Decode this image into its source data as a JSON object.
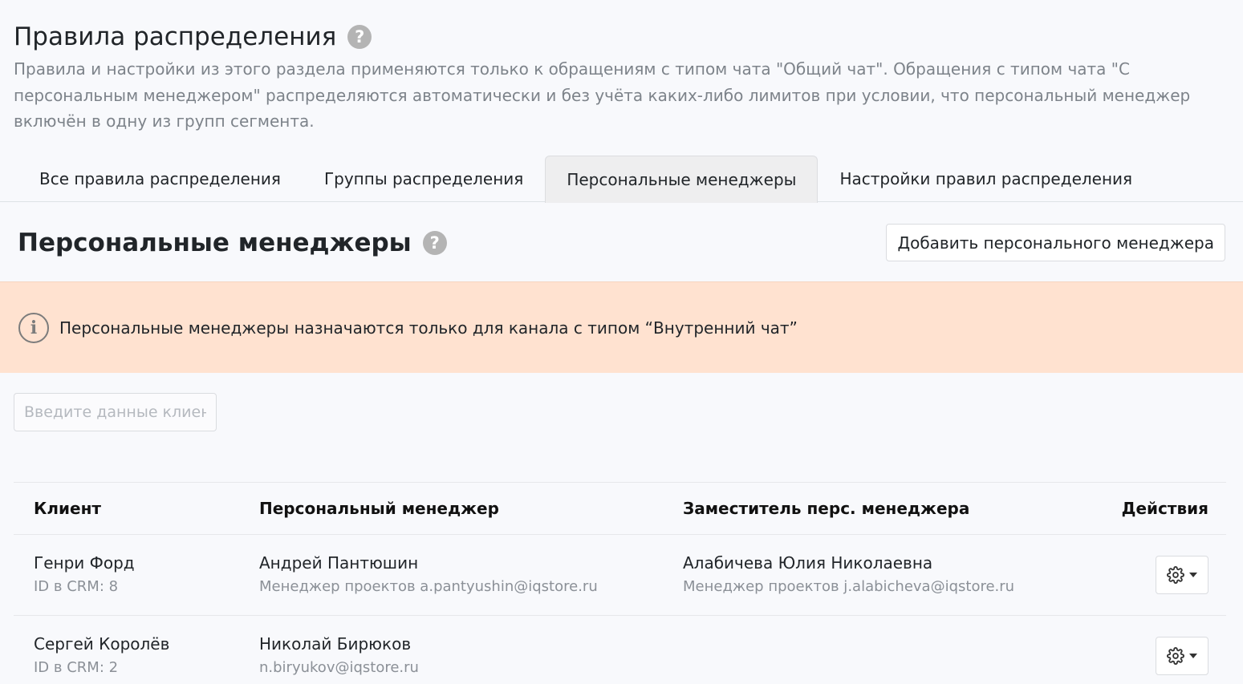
{
  "header": {
    "title": "Правила распределения",
    "description": "Правила и настройки из этого раздела применяются только к обращениям с типом чата \"Общий чат\". Обращения с типом чата \"С персональным менеджером\" распределяются автоматически и без учёта каких-либо лимитов при условии, что персональный менеджер включён в одну из групп сегмента."
  },
  "tabs": [
    {
      "label": "Все правила распределения",
      "active": false
    },
    {
      "label": "Группы распределения",
      "active": false
    },
    {
      "label": "Персональные менеджеры",
      "active": true
    },
    {
      "label": "Настройки правил распределения",
      "active": false
    }
  ],
  "section": {
    "title": "Персональные менеджеры",
    "add_button": "Добавить персонального менеджера"
  },
  "alert": {
    "text": "Персональные менеджеры назначаются только для канала с типом “Внутренний чат”"
  },
  "search": {
    "placeholder": "Введите данные клиен"
  },
  "table": {
    "headers": {
      "client": "Клиент",
      "manager": "Персональный менеджер",
      "deputy": "Заместитель перс. менеджера",
      "actions": "Действия"
    },
    "rows": [
      {
        "client_name": "Генри Форд",
        "client_id": "ID в CRM: 8",
        "manager_name": "Андрей Пантюшин",
        "manager_info": "Менеджер проектов a.pantyushin@iqstore.ru",
        "deputy_name": "Алабичева Юлия Николаевна",
        "deputy_info": "Менеджер проектов j.alabicheva@iqstore.ru"
      },
      {
        "client_name": "Сергей Королёв",
        "client_id": "ID в CRM: 2",
        "manager_name": "Николай Бирюков",
        "manager_info": "n.biryukov@iqstore.ru",
        "deputy_name": "",
        "deputy_info": ""
      }
    ]
  },
  "icons": {
    "help": "question-circle-icon",
    "info": "info-circle-icon",
    "gear": "gear-icon",
    "caret": "caret-down-icon"
  },
  "colors": {
    "alert_bg": "#ffe2d0",
    "muted_text": "#7d838a",
    "active_tab_bg": "#eeeeef"
  }
}
